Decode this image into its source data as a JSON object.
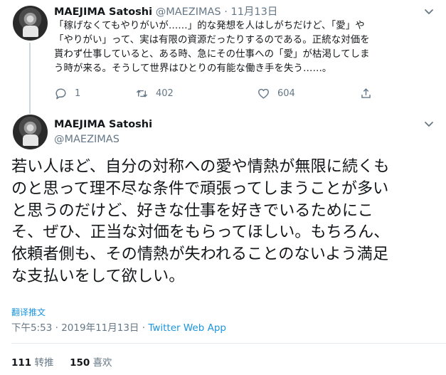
{
  "tweet1": {
    "author_name": "MAEJIMA Satoshi",
    "author_handle": "@MAEZIMAS",
    "separator": "·",
    "date": "11月13日",
    "text_lines": [
      "「稼げなくてもやりがいが……」的な発想を人はしがちだけど、「愛」や",
      "「やりがい」って、実は有限の資源だったりするのである。正統な対価を",
      "貰わず仕事していると、ある時、急にその仕事への「愛」が枯渇してしま",
      "う時が来る。そうして世界はひとりの有能な働き手を失う……。"
    ],
    "reply_count": "1",
    "retweet_count": "402",
    "like_count": "604"
  },
  "tweet2": {
    "author_name": "MAEJIMA Satoshi",
    "author_handle": "@MAEZIMAS",
    "text_lines": [
      "若い人ほど、自分の対称への愛や情熱が無限に続くも",
      "のと思って理不尽な条件で頑張ってしまうことが多い",
      "と思うのだけど、好きな仕事を好きでいるためにこ",
      "そ、ぜひ、正当な対価をもらってほしい。もちろん、",
      "依頼者側も、その情熱が失われることのないよう満足",
      "な支払いをして欲しい。"
    ],
    "translate_label": "翻译推文",
    "time": "下午5:53",
    "meta_sep": "·",
    "date": "2019年11月13日",
    "via": "Twitter Web App",
    "retweet_count": "111",
    "retweet_label": "转推",
    "like_count": "150",
    "like_label": "喜欢"
  },
  "icons": [
    "avatar",
    "chevron-down-icon",
    "reply-icon",
    "retweet-icon",
    "like-icon",
    "share-icon"
  ],
  "colors": {
    "link": "#1b95e0",
    "secondary_text": "#657786",
    "primary_text": "#14171a",
    "thread_line": "#ccd6dd",
    "divider": "#e6ecf0"
  }
}
